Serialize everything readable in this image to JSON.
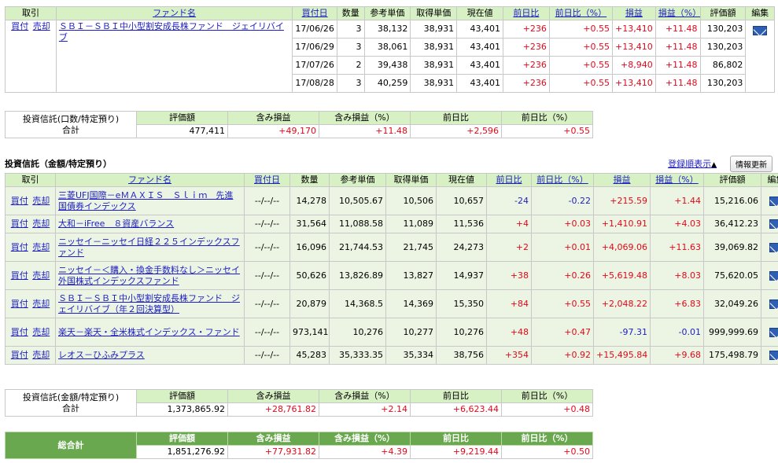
{
  "table1": {
    "headers": {
      "trade": "取引",
      "fund": "ファンド名",
      "date": "買付日",
      "qty": "数量",
      "ref_price": "参考単価",
      "acq_price": "取得単価",
      "cur_price": "現在値",
      "day_chg": "前日比",
      "day_chg_pct": "前日比（%）",
      "pl": "損益",
      "pl_pct": "損益（%）",
      "value": "評価額",
      "edit": "編集"
    },
    "buy": "買付",
    "sell": "売却",
    "fund_name": "ＳＢＩ－ＳＢＩ中小型割安成長株ファンド　ジェイリバイブ",
    "rows": [
      {
        "date": "17/06/26",
        "qty": "3",
        "ref": "38,132",
        "acq": "38,931",
        "cur": "43,401",
        "dc": "+236",
        "dcp": "+0.55",
        "pl": "+13,410",
        "plp": "+11.48",
        "val": "130,203"
      },
      {
        "date": "17/06/29",
        "qty": "3",
        "ref": "38,061",
        "acq": "38,931",
        "cur": "43,401",
        "dc": "+236",
        "dcp": "+0.55",
        "pl": "+13,410",
        "plp": "+11.48",
        "val": "130,203"
      },
      {
        "date": "17/07/26",
        "qty": "2",
        "ref": "39,438",
        "acq": "38,931",
        "cur": "43,401",
        "dc": "+236",
        "dcp": "+0.55",
        "pl": "+8,940",
        "plp": "+11.48",
        "val": "86,802"
      },
      {
        "date": "17/08/28",
        "qty": "3",
        "ref": "40,259",
        "acq": "38,931",
        "cur": "43,401",
        "dc": "+236",
        "dcp": "+0.55",
        "pl": "+13,410",
        "plp": "+11.48",
        "val": "130,203"
      }
    ]
  },
  "summary1": {
    "label1": "投資信託(口数/特定預り)",
    "label2": "合計",
    "h_value": "評価額",
    "h_pl": "含み損益",
    "h_plp": "含み損益（%）",
    "h_dc": "前日比",
    "h_dcp": "前日比（%）",
    "value": "477,411",
    "pl": "+49,170",
    "plp": "+11.48",
    "dc": "+2,596",
    "dcp": "+0.55"
  },
  "section2": {
    "title": "投資信託（金額/特定預り）",
    "sort_link": "登録順表示",
    "sort_arrow": "▲",
    "refresh": "情報更新"
  },
  "table2": {
    "headers": {
      "trade": "取引",
      "fund": "ファンド名",
      "date": "買付日",
      "qty": "数量",
      "ref_price": "参考単価",
      "acq_price": "取得単価",
      "cur_price": "現在値",
      "day_chg": "前日比",
      "day_chg_pct": "前日比（%）",
      "pl": "損益",
      "pl_pct": "損益（%）",
      "value": "評価額",
      "edit": "編集"
    },
    "rows": [
      {
        "fund": "三菱UFJ国際－eＭＡＸＩＳ　Ｓｌｉｍ　先進国債券インデックス",
        "date": "--/--/--",
        "qty": "14,278",
        "ref": "10,505.67",
        "acq": "10,506",
        "cur": "10,657",
        "dc": "-24",
        "dcp": "-0.22",
        "pl": "+215.59",
        "plp": "+1.44",
        "val": "15,216.06",
        "dc_color": "blue",
        "pl_color": "red"
      },
      {
        "fund": "大和－iFree　８資産バランス",
        "date": "--/--/--",
        "qty": "31,564",
        "ref": "11,088.58",
        "acq": "11,089",
        "cur": "11,536",
        "dc": "+4",
        "dcp": "+0.03",
        "pl": "+1,410.91",
        "plp": "+4.03",
        "val": "36,412.23",
        "dc_color": "red",
        "pl_color": "red"
      },
      {
        "fund": "ニッセイ－ニッセイ日経２２５インデックスファンド",
        "date": "--/--/--",
        "qty": "16,096",
        "ref": "21,744.53",
        "acq": "21,745",
        "cur": "24,273",
        "dc": "+2",
        "dcp": "+0.01",
        "pl": "+4,069.06",
        "plp": "+11.63",
        "val": "39,069.82",
        "dc_color": "red",
        "pl_color": "red"
      },
      {
        "fund": "ニッセイ－＜購入・換金手数料なし＞ニッセイ外国株式インデックスファンド",
        "date": "--/--/--",
        "qty": "50,626",
        "ref": "13,826.89",
        "acq": "13,827",
        "cur": "14,937",
        "dc": "+38",
        "dcp": "+0.26",
        "pl": "+5,619.48",
        "plp": "+8.03",
        "val": "75,620.05",
        "dc_color": "red",
        "pl_color": "red"
      },
      {
        "fund": "ＳＢＩ－ＳＢＩ中小型割安成長株ファンド　ジェイリバイブ（年２回決算型）",
        "date": "--/--/--",
        "qty": "20,879",
        "ref": "14,368.5",
        "acq": "14,369",
        "cur": "15,350",
        "dc": "+84",
        "dcp": "+0.55",
        "pl": "+2,048.22",
        "plp": "+6.83",
        "val": "32,049.26",
        "dc_color": "red",
        "pl_color": "red"
      },
      {
        "fund": "楽天－楽天・全米株式インデックス・ファンド",
        "date": "--/--/--",
        "qty": "973,141",
        "ref": "10,276",
        "acq": "10,277",
        "cur": "10,276",
        "dc": "+48",
        "dcp": "+0.47",
        "pl": "-97.31",
        "plp": "-0.01",
        "val": "999,999.69",
        "dc_color": "red",
        "pl_color": "blue"
      },
      {
        "fund": "レオス－ひふみプラス",
        "date": "--/--/--",
        "qty": "45,283",
        "ref": "35,333.35",
        "acq": "35,334",
        "cur": "38,756",
        "dc": "+354",
        "dcp": "+0.92",
        "pl": "+15,495.84",
        "plp": "+9.68",
        "val": "175,498.79",
        "dc_color": "red",
        "pl_color": "red"
      }
    ]
  },
  "summary2": {
    "label1": "投資信託(金額/特定預り)",
    "label2": "合計",
    "h_value": "評価額",
    "h_pl": "含み損益",
    "h_plp": "含み損益（%）",
    "h_dc": "前日比",
    "h_dcp": "前日比（%）",
    "value": "1,373,865.92",
    "pl": "+28,761.82",
    "plp": "+2.14",
    "dc": "+6,623.44",
    "dcp": "+0.48"
  },
  "grand_total": {
    "label": "総合計",
    "h_value": "評価額",
    "h_pl": "含み損益",
    "h_plp": "含み損益（%）",
    "h_dc": "前日比",
    "h_dcp": "前日比（%）",
    "value": "1,851,276.92",
    "pl": "+77,931.82",
    "plp": "+4.39",
    "dc": "+9,219.44",
    "dcp": "+0.50"
  }
}
